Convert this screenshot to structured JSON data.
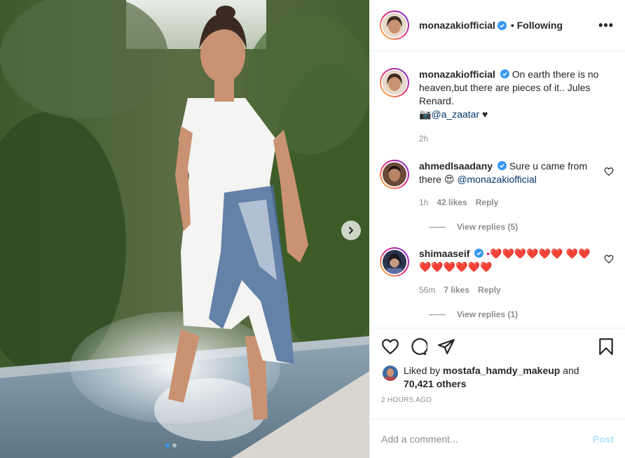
{
  "post_author": {
    "username": "monazakiofficial",
    "separator": "•",
    "follow_status": "Following",
    "more_label": "•••"
  },
  "caption": {
    "username": "monazakiofficial",
    "text": "On earth there is no heaven,but there are pieces of it.. Jules Renard.",
    "camera_emoji": "📷",
    "mention": "@a_zaatar",
    "heart": "♥",
    "time": "2h"
  },
  "comments": [
    {
      "username": "ahmedlsaadany",
      "text": "Sure u came from there",
      "emoji": "😍",
      "mention": "@monazakiofficial",
      "time": "1h",
      "likes": "42 likes",
      "reply": "Reply",
      "view_replies": "View replies (5)"
    },
    {
      "username": "shimaaseif",
      "text": "•❤️❤️❤️❤️❤️❤️ ❤️❤️❤️❤️❤️❤️❤️❤️",
      "time": "56m",
      "likes": "7 likes",
      "reply": "Reply",
      "view_replies": "View replies (1)"
    }
  ],
  "likes": {
    "prefix": "Liked by",
    "user": "mostafa_hamdy_makeup",
    "joiner": "and",
    "count": "70,421 others"
  },
  "timestamp": "2 HOURS AGO",
  "add_comment": {
    "placeholder": "Add a comment...",
    "post_label": "Post"
  },
  "carousel": {
    "slide_index": 1,
    "slide_count": 2
  },
  "colors": {
    "verified": "#3897f0",
    "link": "#00376b",
    "muted": "#8e8e8e",
    "post_disabled": "#b2dffc"
  },
  "icons": [
    "more-options-icon",
    "verified-badge-icon",
    "heart-icon",
    "comment-icon",
    "share-icon",
    "bookmark-icon",
    "chevron-right-icon"
  ]
}
